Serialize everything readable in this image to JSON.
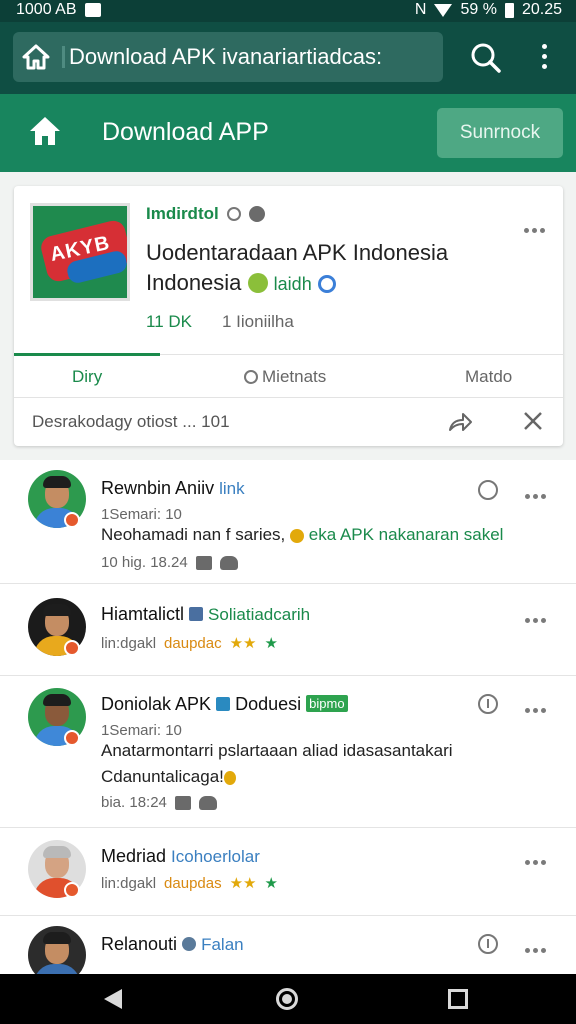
{
  "status_bar": {
    "time_left": "1000 AB",
    "signal": "N",
    "battery_pct": "59 %",
    "clock": "20.25"
  },
  "browser": {
    "url": "Download APK ivanariartiadcas:"
  },
  "app_header": {
    "title": "Download APP",
    "action_label": "Sunrnock"
  },
  "app_card": {
    "developer": "Imdirdtol",
    "name_line1": "Uodentaradaan APK Indonesia",
    "name_line2": "Indonesia",
    "name_tag": "laidh",
    "downloads": "11 DK",
    "reviews": "1 Iioniilha",
    "tabs": [
      {
        "label": "Diry"
      },
      {
        "label": "Mietnats"
      },
      {
        "label": "Matdo"
      }
    ],
    "footer_text": "Desrakodagy otiost ...",
    "footer_count": "101"
  },
  "posts": [
    {
      "name": "Rewnbin Aniiv",
      "name_extra": "link",
      "meta": "1Semari: 10",
      "body_pre": "Neohamadi nan f saries,",
      "body_hl": "eka APK nakanaran",
      "body_post": " sakel",
      "foot_text": "10 hig. 18.24"
    },
    {
      "name": "Hiamtalictl",
      "name_extra": "Soliatiadcarih",
      "foot_text": "lin:dgakl",
      "foot_tag": "daupdac",
      "stars": "★★",
      "star_extra": "★"
    },
    {
      "name": "Doniolak APK",
      "name_extra": "Doduesi",
      "pill": "bipmo",
      "meta": "1Semari: 10",
      "body_line1": "Anatarmontarri pslartaaan aliad idasasantakari",
      "body_line2": "Cdanuntalicaga!",
      "foot_text": "bia. 18:24"
    },
    {
      "name": "Medriad",
      "name_extra": "Icohoerlolar",
      "foot_text": "lin:dgakl",
      "foot_tag": "daupdas",
      "stars": "★★",
      "star_extra": "★"
    },
    {
      "name": "Relanouti",
      "name_extra": "Falan"
    }
  ],
  "colors": {
    "brand_green": "#18855e",
    "dark_bar": "#0f4e43",
    "accent": "#1a8a4b"
  }
}
